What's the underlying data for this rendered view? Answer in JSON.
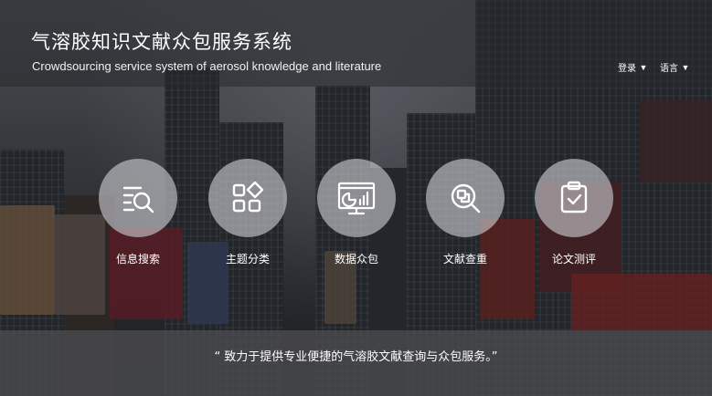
{
  "header": {
    "title_cn": "气溶胶知识文献众包服务系统",
    "title_en": "Crowdsourcing service system of aerosol knowledge and literature",
    "login_label": "登录",
    "language_label": "语言",
    "caret_glyph": "▼"
  },
  "features": [
    {
      "label": "信息搜索",
      "icon": "search-list-icon"
    },
    {
      "label": "主题分类",
      "icon": "category-grid-icon"
    },
    {
      "label": "数据众包",
      "icon": "data-dashboard-icon"
    },
    {
      "label": "文献查重",
      "icon": "duplicate-check-icon"
    },
    {
      "label": "论文测评",
      "icon": "clipboard-check-icon"
    }
  ],
  "slogan": "“ 致力于提供专业便捷的气溶胶文献查询与众包服务。”",
  "colors": {
    "icon_stroke": "#ffffff",
    "circle_fill": "rgba(205,205,210,0.62)",
    "band_fill": "rgba(75,75,78,0.78)"
  }
}
